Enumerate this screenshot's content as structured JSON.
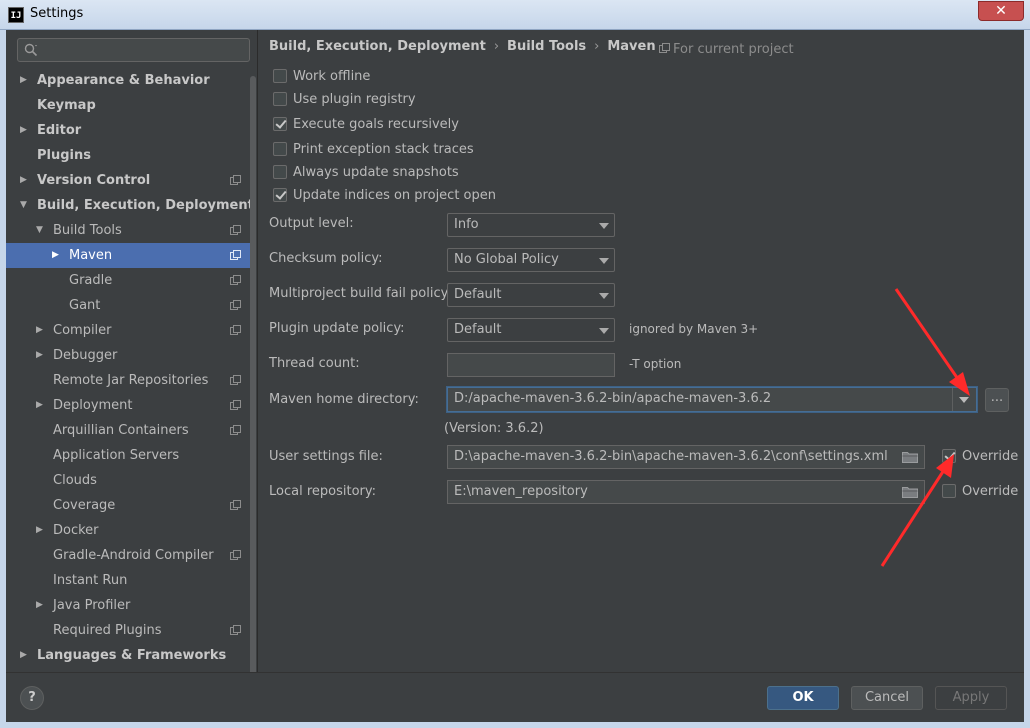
{
  "window": {
    "title": "Settings",
    "close_label": "✕",
    "app_icon_text": "IJ"
  },
  "sidebar": {
    "search_placeholder": "",
    "items": [
      {
        "label": "Appearance & Behavior",
        "bold": true
      },
      {
        "label": "Keymap",
        "bold": true
      },
      {
        "label": "Editor",
        "bold": true
      },
      {
        "label": "Plugins",
        "bold": true
      },
      {
        "label": "Version Control",
        "bold": true
      },
      {
        "label": "Build, Execution, Deployment",
        "bold": true
      },
      {
        "label": "Build Tools"
      },
      {
        "label": "Maven",
        "selected": true
      },
      {
        "label": "Gradle"
      },
      {
        "label": "Gant"
      },
      {
        "label": "Compiler"
      },
      {
        "label": "Debugger"
      },
      {
        "label": "Remote Jar Repositories"
      },
      {
        "label": "Deployment"
      },
      {
        "label": "Arquillian Containers"
      },
      {
        "label": "Application Servers"
      },
      {
        "label": "Clouds"
      },
      {
        "label": "Coverage"
      },
      {
        "label": "Docker"
      },
      {
        "label": "Gradle-Android Compiler"
      },
      {
        "label": "Instant Run"
      },
      {
        "label": "Java Profiler"
      },
      {
        "label": "Required Plugins"
      },
      {
        "label": "Languages & Frameworks",
        "bold": true
      }
    ]
  },
  "breadcrumb": [
    "Build, Execution, Deployment",
    "Build Tools",
    "Maven"
  ],
  "breadcrumb_sep": "›",
  "for_current_project": "For current project",
  "checkboxes": [
    {
      "label": "Work offline",
      "checked": false
    },
    {
      "label": "Use plugin registry",
      "checked": false
    },
    {
      "label": "Execute goals recursively",
      "checked": true
    },
    {
      "label": "Print exception stack traces",
      "checked": false
    },
    {
      "label": "Always update snapshots",
      "checked": false
    },
    {
      "label": "Update indices on project open",
      "checked": true
    }
  ],
  "fields": {
    "output_level": {
      "label": "Output level:",
      "value": "Info"
    },
    "checksum_policy": {
      "label": "Checksum policy:",
      "value": "No Global Policy"
    },
    "multiproject_fail": {
      "label": "Multiproject build fail policy:",
      "value": "Default"
    },
    "plugin_update": {
      "label": "Plugin update policy:",
      "value": "Default",
      "hint": "ignored by Maven 3+"
    },
    "thread_count": {
      "label": "Thread count:",
      "value": "",
      "hint": "-T option"
    },
    "maven_home": {
      "label": "Maven home directory:",
      "value": "D:/apache-maven-3.6.2-bin/apache-maven-3.6.2",
      "browse": "..."
    },
    "version": "(Version: 3.6.2)",
    "user_settings": {
      "label": "User settings file:",
      "value": "D:\\apache-maven-3.6.2-bin\\apache-maven-3.6.2\\conf\\settings.xml",
      "override_label": "Override",
      "override": true
    },
    "local_repo": {
      "label": "Local repository:",
      "value": "E:\\maven_repository",
      "override_label": "Override",
      "override": false
    }
  },
  "footer": {
    "help": "?",
    "ok": "OK",
    "cancel": "Cancel",
    "apply": "Apply"
  },
  "colors": {
    "accent": "#4b6eaf",
    "annotation": "#ff2a2a"
  },
  "icons": [
    "search-icon",
    "project-scope-icon",
    "folder-icon",
    "chevron-down-icon",
    "expand-arrow-icon",
    "help-icon"
  ]
}
